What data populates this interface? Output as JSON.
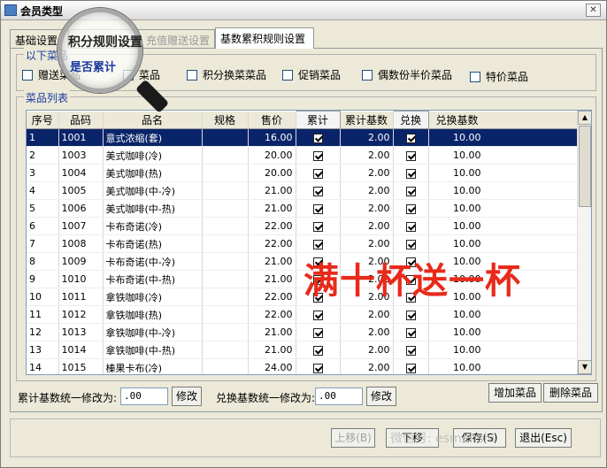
{
  "window": {
    "title": "会员类型"
  },
  "tabs": [
    {
      "label": "基础设置"
    },
    {
      "label": "充值赠送设置"
    },
    {
      "label": "基数累积规则设置"
    }
  ],
  "filters": {
    "legend": "以下菜品",
    "options": [
      "赠送菜品",
      "菜品",
      "积分换菜菜品",
      "促销菜品",
      "偶数份半价菜品",
      "特价菜品"
    ]
  },
  "magnifier": {
    "line1": "积分规则设置",
    "line2": "是否累计"
  },
  "grid": {
    "legend": "菜品列表",
    "columns": [
      "序号",
      "品码",
      "品名",
      "规格",
      "售价",
      "累计",
      "累计基数",
      "兑换",
      "兑换基数"
    ],
    "rows": [
      [
        "1",
        "1001",
        "意式浓缩(套)",
        "",
        "16.00",
        "2.00",
        "10.00"
      ],
      [
        "2",
        "1003",
        "美式咖啡(冷)",
        "",
        "20.00",
        "2.00",
        "10.00"
      ],
      [
        "3",
        "1004",
        "美式咖啡(热)",
        "",
        "20.00",
        "2.00",
        "10.00"
      ],
      [
        "4",
        "1005",
        "美式咖啡(中-冷)",
        "",
        "21.00",
        "2.00",
        "10.00"
      ],
      [
        "5",
        "1006",
        "美式咖啡(中-热)",
        "",
        "21.00",
        "2.00",
        "10.00"
      ],
      [
        "6",
        "1007",
        "卡布奇诺(冷)",
        "",
        "22.00",
        "2.00",
        "10.00"
      ],
      [
        "7",
        "1008",
        "卡布奇诺(热)",
        "",
        "22.00",
        "2.00",
        "10.00"
      ],
      [
        "8",
        "1009",
        "卡布奇诺(中-冷)",
        "",
        "21.00",
        "2.00",
        "10.00"
      ],
      [
        "9",
        "1010",
        "卡布奇诺(中-热)",
        "",
        "21.00",
        "2.00",
        "10.00"
      ],
      [
        "10",
        "1011",
        "拿铁咖啡(冷)",
        "",
        "22.00",
        "2.00",
        "10.00"
      ],
      [
        "11",
        "1012",
        "拿铁咖啡(热)",
        "",
        "22.00",
        "2.00",
        "10.00"
      ],
      [
        "12",
        "1013",
        "拿铁咖啡(中-冷)",
        "",
        "21.00",
        "2.00",
        "10.00"
      ],
      [
        "13",
        "1014",
        "拿铁咖啡(中-热)",
        "",
        "21.00",
        "2.00",
        "10.00"
      ],
      [
        "14",
        "1015",
        "榛果卡布(冷)",
        "",
        "24.00",
        "2.00",
        "10.00"
      ]
    ]
  },
  "overlay": {
    "text": "满十杯送一杯"
  },
  "bulk": {
    "acc_label": "累计基数统一修改为:",
    "acc_value": ".00",
    "acc_button": "修改",
    "exch_label": "兑换基数统一修改为:",
    "exch_value": ".00",
    "exch_button": "修改",
    "add_button": "增加菜品",
    "delete_button": "删除菜品"
  },
  "footer": {
    "prev_button": "上移(B)",
    "next_button": "下移",
    "save_button": "保存(S)",
    "exit_button": "退出(Esc)",
    "watermark": "微信号: esmenshi"
  }
}
